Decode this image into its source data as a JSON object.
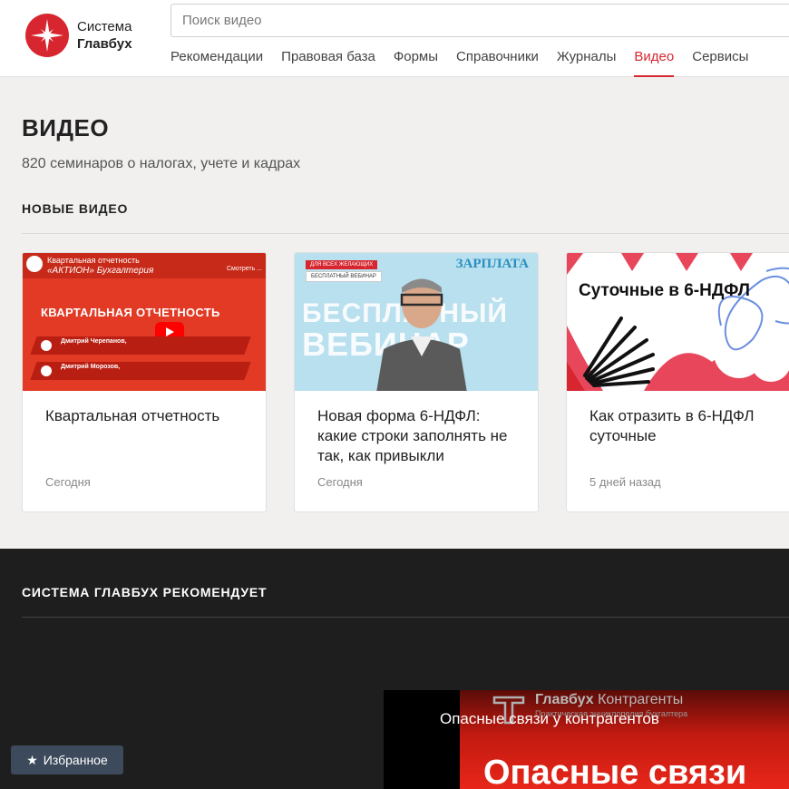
{
  "header": {
    "logo_line1": "Система",
    "logo_line2": "Главбух",
    "search_placeholder": "Поиск видео",
    "nav": [
      {
        "label": "Рекомендации"
      },
      {
        "label": "Правовая база"
      },
      {
        "label": "Формы"
      },
      {
        "label": "Справочники"
      },
      {
        "label": "Журналы"
      },
      {
        "label": "Видео",
        "active": true
      },
      {
        "label": "Сервисы"
      }
    ]
  },
  "main": {
    "title": "ВИДЕО",
    "subtitle": "820 семинаров о налогах, учете и кадрах",
    "section_title": "НОВЫЕ ВИДЕО",
    "cards": [
      {
        "title": "Квартальная отчетность",
        "date": "Сегодня",
        "thumb": {
          "header1": "Квартальная отчетность",
          "header2": "«АКТИОН» Бухгалтерия",
          "watch": "Смотреть ...",
          "big": "КВАРТАЛЬНАЯ ОТЧЕТНОСТЬ",
          "speaker1": "Дмитрий Черепанов,",
          "speaker2": "Дмитрий Морозов,"
        }
      },
      {
        "title": "Новая форма 6-НДФЛ: какие строки заполнять не так, как привыкли",
        "date": "Сегодня",
        "thumb": {
          "tag1": "ДЛЯ ВСЕХ ЖЕЛАЮЩИХ",
          "tag2": "БЕСПЛАТНЫЙ ВЕБИНАР",
          "brand": "ЗАРПЛАТА",
          "wm1": "БЕСПЛАТНЫЙ",
          "wm2": "ВЕБИНАР"
        }
      },
      {
        "title": "Как отразить в 6-НДФЛ суточные",
        "date": "5 дней назад",
        "thumb": {
          "title": "Суточные в 6-НДФЛ"
        }
      }
    ]
  },
  "recommend": {
    "title": "СИСТЕМА ГЛАВБУХ РЕКОМЕНДУЕТ",
    "video": {
      "brand_bold": "Главбух",
      "brand_rest": " Контрагенты",
      "brand_sub": "Практическая энциклопедия бухгалтера",
      "title": "Опасные связи у контрагентов",
      "big": "Опасные связи"
    }
  },
  "favorites": {
    "label": "Избранное"
  },
  "colors": {
    "accent": "#d7262f",
    "dark_bg": "#1e1e1e",
    "page_bg": "#f1f0ef"
  }
}
